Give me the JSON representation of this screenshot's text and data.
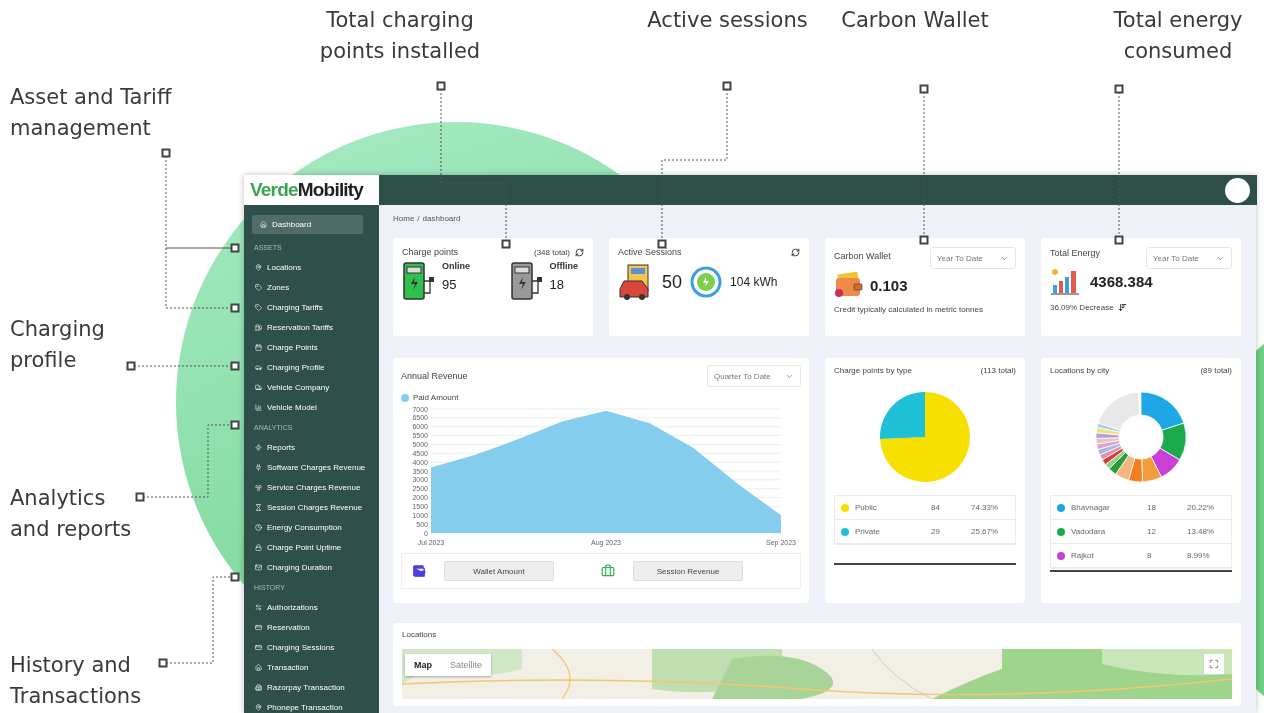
{
  "annotations": [
    {
      "text": "Total charging points installed"
    },
    {
      "text": "Active sessions"
    },
    {
      "text": "Carbon Wallet"
    },
    {
      "text": "Total energy consumed"
    },
    {
      "text": "Asset and Tariff management"
    },
    {
      "text": "Charging profile"
    },
    {
      "text": "Analytics and reports"
    },
    {
      "text": "History and Transactions"
    }
  ],
  "brand": {
    "accent": "Verde",
    "rest": "Mobility"
  },
  "sidebar": {
    "items": [
      {
        "kind": "item",
        "label": "Dashboard",
        "selected": true
      },
      {
        "kind": "header",
        "label": "ASSETS"
      },
      {
        "kind": "item",
        "label": "Locations",
        "selected": false
      },
      {
        "kind": "item",
        "label": "Zones",
        "selected": false
      },
      {
        "kind": "item",
        "label": "Charging Tariffs",
        "selected": false
      },
      {
        "kind": "item",
        "label": "Reservation Tariffs",
        "selected": false
      },
      {
        "kind": "item",
        "label": "Charge Points",
        "selected": false
      },
      {
        "kind": "item",
        "label": "Charging Profile",
        "selected": false
      },
      {
        "kind": "item",
        "label": "Vehicle Company",
        "selected": false
      },
      {
        "kind": "item",
        "label": "Vehicle Model",
        "selected": false
      },
      {
        "kind": "header",
        "label": "ANALYTICS"
      },
      {
        "kind": "item",
        "label": "Reports",
        "selected": false
      },
      {
        "kind": "item",
        "label": "Software Charges Revenue",
        "selected": false
      },
      {
        "kind": "item",
        "label": "Service Charges Revenue",
        "selected": false
      },
      {
        "kind": "item",
        "label": "Session Charges Revenue",
        "selected": false
      },
      {
        "kind": "item",
        "label": "Energy Consumption",
        "selected": false
      },
      {
        "kind": "item",
        "label": "Charge Point Uptime",
        "selected": false
      },
      {
        "kind": "item",
        "label": "Charging Duration",
        "selected": false
      },
      {
        "kind": "header",
        "label": "HISTORY"
      },
      {
        "kind": "item",
        "label": "Authorizations",
        "selected": false
      },
      {
        "kind": "item",
        "label": "Reservation",
        "selected": false
      },
      {
        "kind": "item",
        "label": "Charging Sessions",
        "selected": false
      },
      {
        "kind": "item",
        "label": "Transaction",
        "selected": false
      },
      {
        "kind": "item",
        "label": "Razorpay Transaction",
        "selected": false
      },
      {
        "kind": "item",
        "label": "Phonepe Transaction",
        "selected": false
      }
    ]
  },
  "breadcrumb": [
    "Home",
    "/",
    "dashboard"
  ],
  "charge_points": {
    "title": "Charge points",
    "total": "(348 total)",
    "statuses": [
      {
        "label": "Online",
        "count": "95",
        "online": true
      },
      {
        "label": "Offline",
        "count": "18",
        "online": false
      }
    ]
  },
  "active_sessions": {
    "title": "Active Sessions",
    "count": "50",
    "energy": "104 kWh"
  },
  "carbon_wallet": {
    "title": "Carbon Wallet",
    "period": "Year To Date",
    "value": "0.103",
    "note": "Credit typically calculated in metric tonnes"
  },
  "total_energy": {
    "title": "Total Energy",
    "period": "Year To Date",
    "value": "4368.384",
    "change": "36.09% Decrease"
  },
  "annual_revenue": {
    "title": "Annual Revenue",
    "period": "Quarter To Date",
    "chart_data": {
      "type": "area",
      "categories": [
        "Jul 2023",
        null,
        null,
        null,
        "Aug 2023",
        null,
        null,
        null,
        "Sep 2023"
      ],
      "grid": true,
      "series": [
        {
          "name": "Paid Amount",
          "color": "#84cdee",
          "values": [
            3700,
            4400,
            5300,
            6300,
            6900,
            6200,
            4800,
            2800,
            1000
          ]
        }
      ],
      "ylim": [
        0,
        7000
      ],
      "yticks": [
        0,
        500,
        1000,
        1500,
        2000,
        2500,
        3000,
        3500,
        4000,
        4500,
        5000,
        5500,
        6000,
        6500,
        7000
      ]
    },
    "buttons": [
      "Wallet Amount",
      "Session Revenue"
    ]
  },
  "charge_points_by_type": {
    "title": "Charge points by type",
    "total": "(113 total)",
    "chart_data": {
      "type": "pie",
      "categories": [
        "Public",
        "Private"
      ],
      "values": [
        74.33,
        25.67
      ]
    },
    "legend": [
      {
        "count": "84",
        "share": "74.33%",
        "color": "#f7e000"
      },
      {
        "count": "29",
        "share": "25.67%",
        "color": "#1ec0d6"
      }
    ]
  },
  "locations_by_city": {
    "title": "Locations by city",
    "total": "(89 total)",
    "legend": [
      {
        "label": "Bhavnagar",
        "count": "18",
        "share": "20.22%",
        "color": "#1ea7e6"
      },
      {
        "label": "Vadodara",
        "count": "12",
        "share": "13.48%",
        "color": "#1bab4c"
      },
      {
        "label": "Rajkot",
        "count": "8",
        "share": "8.99%",
        "color": "#c93fd8"
      }
    ]
  },
  "locations": {
    "title": "Locations",
    "map_modes": [
      {
        "label": "Map",
        "selected": true
      },
      {
        "label": "Satellite",
        "selected": false
      }
    ]
  }
}
